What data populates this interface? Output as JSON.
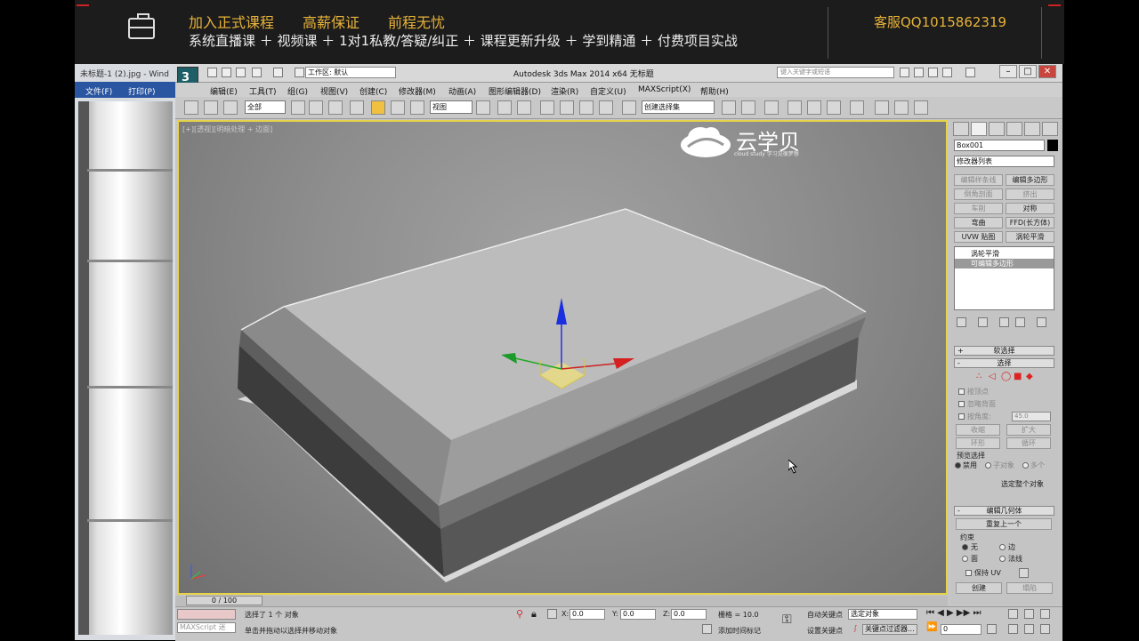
{
  "banner": {
    "line1": "加入正式课程　　高薪保证　　前程无忧",
    "line2": "系统直播课 ＋ 视频课 ＋ 1对1私教/答疑/纠正 ＋ 课程更新升级 ＋ 学到精通 ＋ 付费项目实战",
    "service": "客服QQ1015862319"
  },
  "viewer": {
    "title": "未标题-1 (2).jpg - Wind",
    "menu": [
      "文件(F)",
      "打印(P)"
    ]
  },
  "max": {
    "title": "Autodesk 3ds Max  2014 x64      无标题",
    "workspace": "工作区: 默认",
    "search_placeholder": "键入关键字或短语",
    "menu": [
      "编辑(E)",
      "工具(T)",
      "组(G)",
      "视图(V)",
      "创建(C)",
      "修改器(M)",
      "动画(A)",
      "图形编辑器(D)",
      "渲染(R)",
      "自定义(U)",
      "MAXScript(X)",
      "帮助(H)"
    ],
    "toolbar": {
      "filter": "全部",
      "coord": "视图",
      "selection_set": "创建选择集"
    },
    "viewport": {
      "label": "[+][透视][明暗处理 + 边面]",
      "brand_name": "云学贝",
      "brand_sub": "cloud study   学习见很梦想"
    },
    "panel": {
      "object_name": "Box001",
      "modifier_list": "修改器列表",
      "buttons": [
        "编辑样条线",
        "编辑多边形",
        "倒角剖面",
        "挤出",
        "车削",
        "对称",
        "弯曲",
        "FFD(长方体)",
        "UVW 贴图",
        "涡轮平滑"
      ],
      "stack": [
        "涡轮平滑",
        "可编辑多边形"
      ],
      "soft_selection": "软选择",
      "selection": "选择",
      "checks": [
        "按顶点",
        "忽略背面",
        "按角度:"
      ],
      "angle": "45.0",
      "shrink": "收缩",
      "grow": "扩大",
      "ring": "环形",
      "loop": "循环",
      "preview": "预览选择",
      "preview_opts": [
        "禁用",
        "子对象",
        "多个"
      ],
      "whole_object": "选定整个对象",
      "edit_geom": "编辑几何体",
      "repeat_last": "重复上一个",
      "constraints": "约束",
      "constraint_opts": [
        "无",
        "边",
        "面",
        "法线"
      ],
      "keep_uv": "保持 UV",
      "create": "创建",
      "collapse": "塌陷"
    },
    "timeline": {
      "slider": "0 / 100"
    },
    "status": {
      "maxscript": "MAXScript 迷",
      "selected": "选择了 1 个 对象",
      "prompt": "单击并拖动以选择并移动对象",
      "x": "0.0",
      "y": "0.0",
      "z": "0.0",
      "grid": "栅格 = 10.0",
      "add_time_tag": "添加时间标记",
      "auto_key": "自动关键点",
      "selected_obj": "选定对象",
      "set_key": "设置关键点",
      "key_filters": "关键点过滤器...",
      "frame": "0"
    }
  }
}
